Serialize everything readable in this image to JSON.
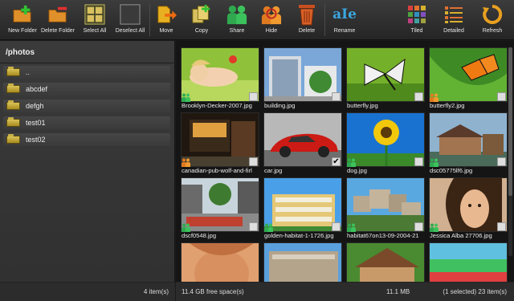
{
  "toolbar": {
    "buttons": [
      {
        "label": "New Folder",
        "icon": "new-folder-icon"
      },
      {
        "label": "Delete Folder",
        "icon": "delete-folder-icon"
      },
      {
        "label": "Select All",
        "icon": "select-all-icon"
      },
      {
        "label": "Deselect All",
        "icon": "deselect-all-icon"
      },
      {
        "label": "Move",
        "icon": "move-icon"
      },
      {
        "label": "Copy",
        "icon": "copy-icon"
      },
      {
        "label": "Share",
        "icon": "share-icon"
      },
      {
        "label": "Hide",
        "icon": "hide-icon"
      },
      {
        "label": "Delete",
        "icon": "trash-icon"
      },
      {
        "label": "Rename",
        "icon": "rename-icon",
        "glyph": "aIe"
      },
      {
        "label": "Tiled",
        "icon": "tiled-view-icon"
      },
      {
        "label": "Detailed",
        "icon": "detailed-view-icon"
      },
      {
        "label": "Refresh",
        "icon": "refresh-icon"
      }
    ]
  },
  "left_panel": {
    "path": "/photos",
    "folders": [
      "..",
      "abcdef",
      "defgh",
      "test01",
      "test02"
    ],
    "item_count": "4 item(s)"
  },
  "files": [
    {
      "name": "Brooklyn-Decker-2007.jpg",
      "badge": "share",
      "checked": false
    },
    {
      "name": "building.jpg",
      "badge": "",
      "checked": false
    },
    {
      "name": "butterfly.jpg",
      "badge": "",
      "checked": false
    },
    {
      "name": "butterfly2.jpg",
      "badge": "hide",
      "checked": false
    },
    {
      "name": "canadian-pub-wolf-and-firl",
      "badge": "hide",
      "checked": false
    },
    {
      "name": "car.jpg",
      "badge": "",
      "checked": true
    },
    {
      "name": "dog.jpg",
      "badge": "share",
      "checked": false
    },
    {
      "name": "dsc05775lf6.jpg",
      "badge": "share",
      "checked": false
    },
    {
      "name": "dscf0548.jpg",
      "badge": "share",
      "checked": false
    },
    {
      "name": "golden-habitat-1-1726.jpg",
      "badge": "share",
      "checked": false
    },
    {
      "name": "habitat67on13-09-2004-21",
      "badge": "share",
      "checked": false
    },
    {
      "name": "Jessica Alba 27706.jpg",
      "badge": "share",
      "checked": false
    },
    {
      "name": "",
      "badge": "",
      "checked": false
    },
    {
      "name": "",
      "badge": "",
      "checked": false
    },
    {
      "name": "",
      "badge": "",
      "checked": false
    },
    {
      "name": "",
      "badge": "",
      "checked": false
    }
  ],
  "status": {
    "free_space": "11.4 GB free space(s)",
    "size": "11.1 MB",
    "selection": "(1 selected) 23 item(s)"
  },
  "colors": {
    "toolbar_bg": "#2e2e2e",
    "panel_bg": "#333333",
    "grid_bg": "#151515",
    "share_badge": "#2fa84f",
    "hide_badge": "#e07a20",
    "folder": "#c9ad3b"
  }
}
